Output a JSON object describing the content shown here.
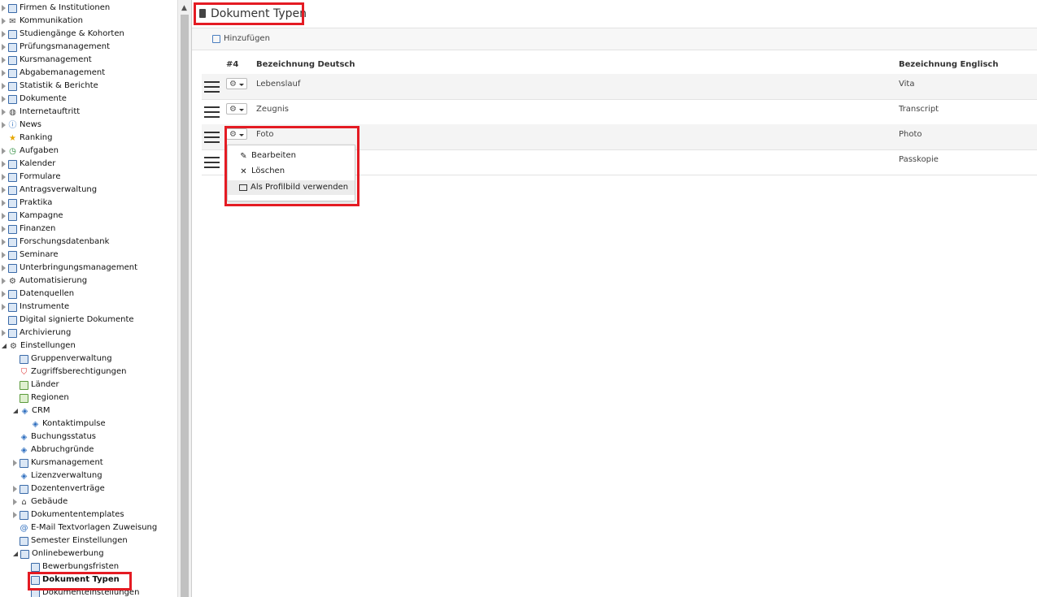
{
  "sidebar": {
    "items": [
      {
        "label": "Firmen & Institutionen",
        "icon": "building-icon"
      },
      {
        "label": "Kommunikation",
        "icon": "envelope-icon"
      },
      {
        "label": "Studiengänge & Kohorten",
        "icon": "feather-icon"
      },
      {
        "label": "Prüfungsmanagement",
        "icon": "checklist-icon"
      },
      {
        "label": "Kursmanagement",
        "icon": "book-icon"
      },
      {
        "label": "Abgabemanagement",
        "icon": "id-card-icon"
      },
      {
        "label": "Statistik & Berichte",
        "icon": "bar-chart-icon"
      },
      {
        "label": "Dokumente",
        "icon": "folder-icon"
      },
      {
        "label": "Internetauftritt",
        "icon": "globe-icon"
      },
      {
        "label": "News",
        "icon": "info-icon"
      },
      {
        "label": "Ranking",
        "icon": "star-icon"
      },
      {
        "label": "Aufgaben",
        "icon": "clock-icon"
      },
      {
        "label": "Kalender",
        "icon": "calendar-icon"
      },
      {
        "label": "Formulare",
        "icon": "form-icon"
      },
      {
        "label": "Antragsverwaltung",
        "icon": "table-icon"
      },
      {
        "label": "Praktika",
        "icon": "grid-icon"
      },
      {
        "label": "Kampagne",
        "icon": "gift-icon"
      },
      {
        "label": "Finanzen",
        "icon": "coins-icon"
      },
      {
        "label": "Forschungsdatenbank",
        "icon": "chart-line-icon"
      },
      {
        "label": "Seminare",
        "icon": "briefcase-icon"
      },
      {
        "label": "Unterbringungsmanagement",
        "icon": "building-tall-icon"
      },
      {
        "label": "Automatisierung",
        "icon": "gear-icon"
      },
      {
        "label": "Datenquellen",
        "icon": "database-icon"
      },
      {
        "label": "Instrumente",
        "icon": "instrument-icon"
      },
      {
        "label": "Digital signierte Dokumente",
        "icon": "signed-document-icon"
      },
      {
        "label": "Archivierung",
        "icon": "archive-icon"
      },
      {
        "label": "Einstellungen",
        "icon": "settings-gear-icon"
      },
      {
        "label": "Gruppenverwaltung",
        "icon": "user-group-icon"
      },
      {
        "label": "Zugriffsberechtigungen",
        "icon": "shield-icon"
      },
      {
        "label": "Länder",
        "icon": "globe-green-icon"
      },
      {
        "label": "Regionen",
        "icon": "globe-region-icon"
      },
      {
        "label": "CRM",
        "icon": "tag-icon"
      },
      {
        "label": "Kontaktimpulse",
        "icon": "tag-icon"
      },
      {
        "label": "Buchungsstatus",
        "icon": "tag-icon"
      },
      {
        "label": "Abbruchgründe",
        "icon": "tag-icon"
      },
      {
        "label": "Kursmanagement",
        "icon": "folder-open-icon"
      },
      {
        "label": "Lizenzverwaltung",
        "icon": "tag-icon"
      },
      {
        "label": "Dozentenverträge",
        "icon": "network-icon"
      },
      {
        "label": "Gebäude",
        "icon": "house-icon"
      },
      {
        "label": "Dokumententemplates",
        "icon": "folder-open-icon"
      },
      {
        "label": "E-Mail Textvorlagen Zuweisung",
        "icon": "at-icon"
      },
      {
        "label": "Semester Einstellungen",
        "icon": "calendar-icon"
      },
      {
        "label": "Onlinebewerbung",
        "icon": "people-icon"
      },
      {
        "label": "Bewerbungsfristen",
        "icon": "table-icon"
      },
      {
        "label": "Dokument Typen",
        "icon": "document-icon"
      },
      {
        "label": "Dokumenteinstellungen",
        "icon": "table-icon"
      }
    ]
  },
  "page": {
    "title": "Dokument Typen",
    "add_label": "Hinzufügen"
  },
  "grid": {
    "columns": {
      "count": "#4",
      "de": "Bezeichnung Deutsch",
      "en": "Bezeichnung Englisch"
    },
    "rows": [
      {
        "de": "Lebenslauf",
        "en": "Vita"
      },
      {
        "de": "Zeugnis",
        "en": "Transcript"
      },
      {
        "de": "Foto",
        "en": "Photo"
      },
      {
        "de": "",
        "en": "Passkopie"
      }
    ]
  },
  "context_menu": {
    "items": [
      {
        "label": "Bearbeiten",
        "icon": "pencil-icon"
      },
      {
        "label": "Löschen",
        "icon": "close-icon"
      },
      {
        "label": "Als Profilbild verwenden",
        "icon": "image-icon"
      }
    ]
  },
  "colors": {
    "highlight": "#e41b23",
    "accent": "#4a7ec0"
  }
}
